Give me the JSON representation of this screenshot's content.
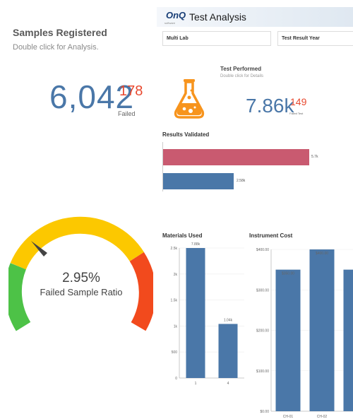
{
  "samples_registered": {
    "title": "Samples Registered",
    "subtitle": "Double click for Analysis.",
    "value": "6,042",
    "failed_value": "178",
    "failed_label": "Failed"
  },
  "header": {
    "logo": "OnQ",
    "logo_sub": "software",
    "title": "Test Analysis"
  },
  "filters": {
    "multi_lab": "Multi Lab",
    "test_result_year": "Test Result Year"
  },
  "test_performed": {
    "title": "Test Performed",
    "subtitle": "Double click for Details",
    "value": "7.86k",
    "failed_value": "149",
    "failed_label": "Failed Test"
  },
  "results_validated": {
    "title": "Results Validated",
    "bar1_label": "5.7k",
    "bar2_label": "2.58k"
  },
  "gauge": {
    "value": "2.95%",
    "label": "Failed Sample Ratio",
    "colors": {
      "low": "#4dc247",
      "mid": "#fcc800",
      "high": "#f24a1d",
      "needle": "#444444"
    }
  },
  "colors": {
    "accent_blue": "#4a77a8",
    "accent_red": "#e8492f",
    "bar_pink": "#c95a70"
  },
  "chart_data": [
    {
      "type": "bar",
      "title": "Materials Used",
      "categories": [
        "1",
        "4"
      ],
      "values": [
        7.88,
        1.04
      ],
      "data_labels": [
        "7.88k",
        "1.04k"
      ],
      "ylim": [
        0,
        2.5
      ],
      "ytick_labels": [
        "0",
        "500",
        "1k",
        "1.5k",
        "2k",
        "2.5k"
      ],
      "grid": true
    },
    {
      "type": "bar",
      "title": "Instrument Cost",
      "categories": [
        "CH-01",
        "CH-02",
        ""
      ],
      "values": [
        350,
        400,
        350
      ],
      "data_labels": [
        "$350.00",
        "$400.00",
        ""
      ],
      "ylim": [
        0,
        400
      ],
      "ytick_labels": [
        "$0.00",
        "$100.00",
        "$200.00",
        "$300.00",
        "$400.00"
      ],
      "grid": true
    }
  ]
}
